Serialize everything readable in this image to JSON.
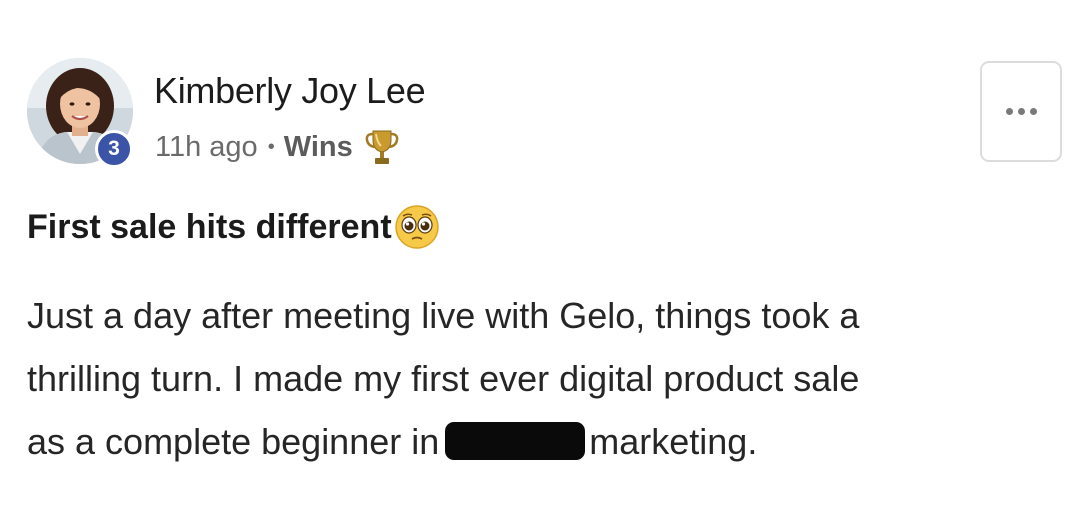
{
  "post": {
    "author": {
      "name": "Kimberly Joy Lee",
      "level": "3",
      "avatar": "profile-photo"
    },
    "meta": {
      "time_ago": "11h ago",
      "separator": "•",
      "category": "Wins",
      "category_icon": "trophy-icon"
    },
    "more_button": {
      "icon": "more-dots-icon"
    },
    "title": "First sale hits different",
    "title_emoji": "pleading-face-icon",
    "body": {
      "line1": "Just a day after meeting live with Gelo, things took a",
      "line2": "thrilling turn. I made my first ever digital product sale",
      "line3_before": "as a complete beginner in",
      "line3_after": "marketing."
    }
  },
  "colors": {
    "level_badge": "#3c54a7",
    "meta_text": "#6a6a6a",
    "redaction": "#0a0a0a",
    "border": "#dcdcdc"
  }
}
